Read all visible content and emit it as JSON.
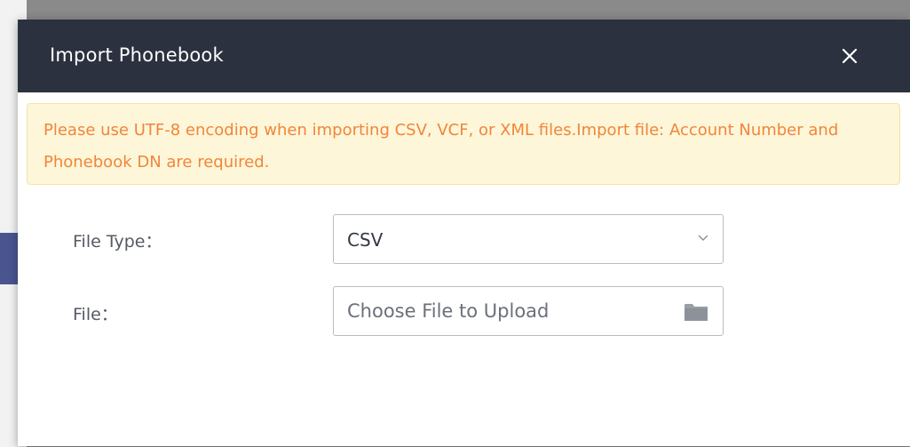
{
  "dialog": {
    "title": "Import Phonebook",
    "close_label": "×"
  },
  "notice": {
    "text": "Please use UTF-8 encoding when importing CSV, VCF, or XML files.Import file: Account Number and Phonebook DN are required."
  },
  "form": {
    "file_type_label": "File Type：",
    "file_type_value": "CSV",
    "file_label": "File：",
    "file_placeholder": "Choose File to Upload"
  },
  "icons": {
    "close": "close-icon",
    "chevron": "chevron-down-icon",
    "folder": "folder-icon"
  },
  "colors": {
    "header_bg": "#2b313f",
    "notice_bg": "#fdf6d9",
    "notice_text": "#f0863a"
  }
}
